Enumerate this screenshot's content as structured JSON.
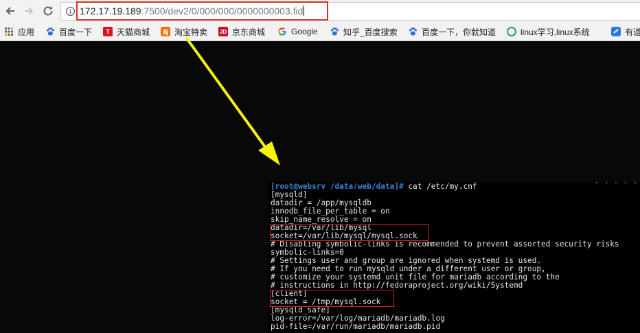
{
  "browser": {
    "url_host": "172.17.19.189",
    "url_path": ":7500/dev2/0/000/000/0000000003.fid",
    "icons": {
      "back": "back-arrow-icon",
      "forward": "forward-arrow-icon",
      "reload": "reload-icon",
      "info": "info-icon"
    }
  },
  "bookmarks": [
    {
      "label": "应用",
      "icon": "apps-grid-icon"
    },
    {
      "label": "百度一下",
      "icon": "baidu-paw-icon"
    },
    {
      "label": "天猫商城",
      "icon": "tmall-icon"
    },
    {
      "label": "淘宝特卖",
      "icon": "taobao-icon"
    },
    {
      "label": "京东商城",
      "icon": "jd-icon"
    },
    {
      "label": "Google",
      "icon": "google-icon"
    },
    {
      "label": "知乎_百度搜索",
      "icon": "baidu-paw-icon"
    },
    {
      "label": "百度一下，你就知道",
      "icon": "baidu-paw-icon"
    },
    {
      "label": "linux学习,linux系统",
      "icon": "linux-site-icon"
    },
    {
      "label": "有道",
      "icon": "youdao-icon"
    }
  ],
  "terminal": {
    "prompt": "[root@websrv /data/web/data]#",
    "command": " cat /etc/my.cnf",
    "lines": [
      "[mysqld]",
      "datadir = /app/mysqldb",
      "innodb_file_per_table = on",
      "skip_name_resolve = on",
      "datadir=/var/lib/mysql",
      "socket=/var/lib/mysql/mysql.sock",
      "# Disabling symbolic-links is recommended to prevent assorted security risks",
      "symbolic-links=0",
      "# Settings user and group are ignored when systemd is used.",
      "# If you need to run mysqld under a different user or group,",
      "# customize your systemd unit file for mariadb according to the",
      "# instructions in http://fedoraproject.org/wiki/Systemd",
      "[client]",
      "socket = /tmp/mysql.sock",
      "[mysqld_safe]",
      "log-error=/var/log/mariadb/mariadb.log",
      "pid-file=/var/run/mariadb/mariadb.pid"
    ]
  },
  "colors": {
    "annotation_box": "#e02020",
    "annotation_arrow": "#f5f20a",
    "prompt": "#3b82d6",
    "page_bg": "#080808"
  }
}
